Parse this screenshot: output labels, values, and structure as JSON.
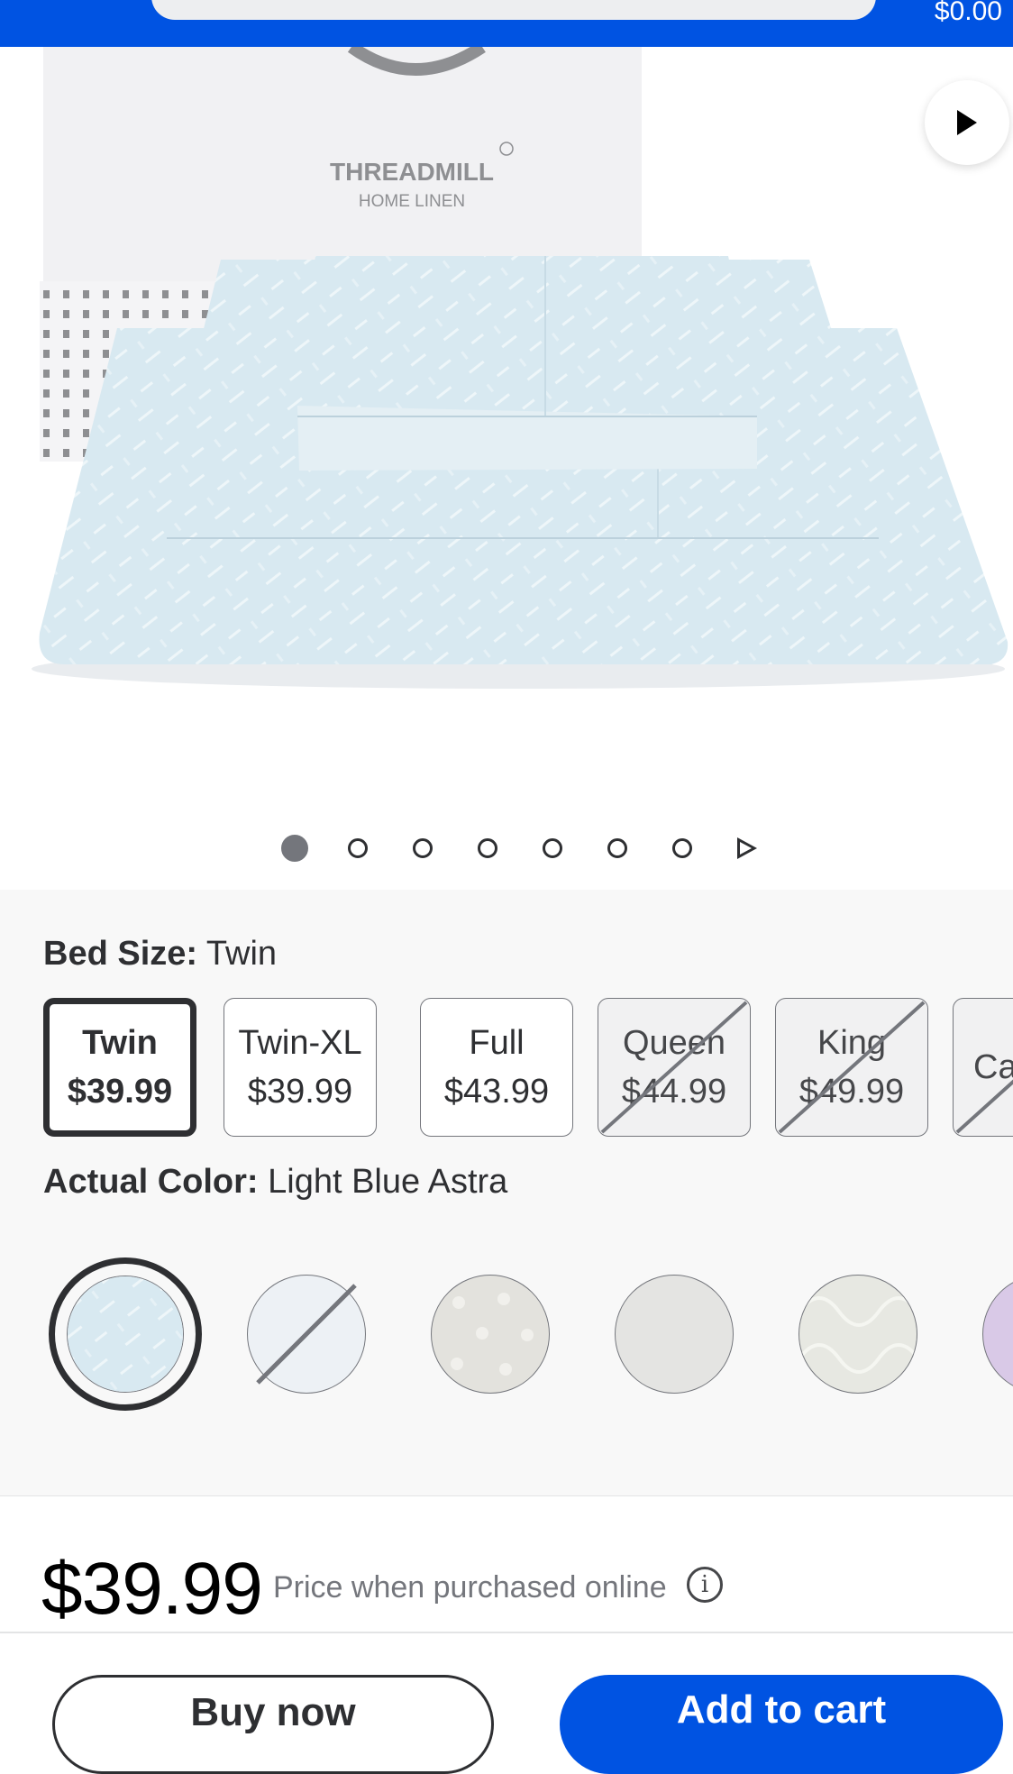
{
  "header": {
    "cart_total": "$0.00"
  },
  "product_image": {
    "brand_name": "THREADMILL",
    "brand_sub": "HOME LINEN",
    "carousel_count": 7,
    "carousel_active": 1
  },
  "bed_size": {
    "label": "Bed Size:",
    "selected": "Twin",
    "options": [
      {
        "name": "Twin",
        "price": "$39.99",
        "selected": true,
        "available": true
      },
      {
        "name": "Twin-XL",
        "price": "$39.99",
        "selected": false,
        "available": true
      },
      {
        "name": "Full",
        "price": "$43.99",
        "selected": false,
        "available": true
      },
      {
        "name": "Queen",
        "price": "$44.99",
        "selected": false,
        "available": false
      },
      {
        "name": "King",
        "price": "$49.99",
        "selected": false,
        "available": false
      },
      {
        "name": "Ca",
        "price": "",
        "selected": false,
        "available": false
      }
    ]
  },
  "color": {
    "label": "Actual Color:",
    "selected": "Light Blue Astra",
    "swatches": [
      {
        "name": "light-blue-astra",
        "color": "#d3e2f0",
        "selected": true,
        "available": true
      },
      {
        "name": "swatch-2",
        "color": "#edf1f5",
        "selected": false,
        "available": false
      },
      {
        "name": "swatch-3",
        "color": "#e3e2dd",
        "selected": false,
        "available": true
      },
      {
        "name": "swatch-4",
        "color": "#e4e4e2",
        "selected": false,
        "available": true
      },
      {
        "name": "swatch-5",
        "color": "#e7e8e2",
        "selected": false,
        "available": true
      },
      {
        "name": "swatch-6",
        "color": "#d9c9e7",
        "selected": false,
        "available": true
      }
    ]
  },
  "pricing": {
    "price": "$39.99",
    "note": "Price when purchased online",
    "info_glyph": "i"
  },
  "actions": {
    "buy_now": "Buy now",
    "add_to_cart": "Add to cart"
  },
  "colors": {
    "brand_blue": "#0053e2",
    "text_dark": "#2e2f32",
    "text_muted": "#74767c",
    "sheet_blue": "#d8e9f1"
  }
}
